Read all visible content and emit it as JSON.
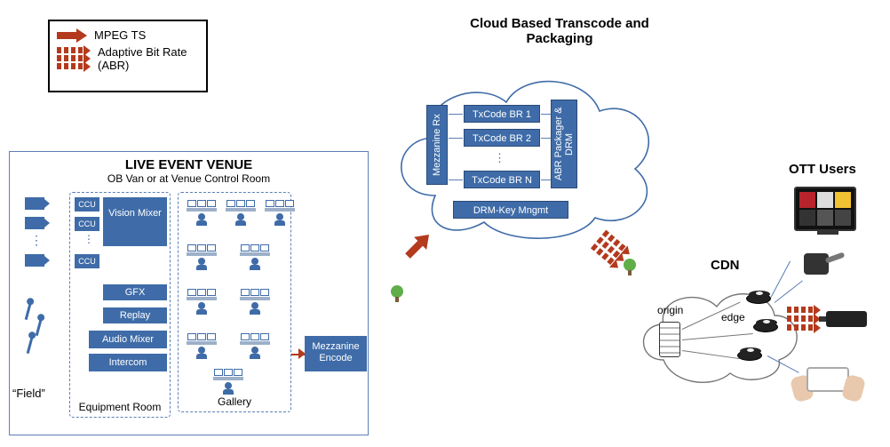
{
  "legend": {
    "mpeg": "MPEG TS",
    "abr": "Adaptive Bit Rate (ABR)"
  },
  "venue": {
    "title": "LIVE EVENT VENUE",
    "subtitle": "OB Van or at Venue Control Room",
    "field": "“Field”",
    "ccu": "CCU",
    "vision_mixer": "Vision Mixer",
    "gfx": "GFX",
    "replay": "Replay",
    "audio_mixer": "Audio Mixer",
    "intercom": "Intercom",
    "equipment_room": "Equipment Room",
    "gallery": "Gallery"
  },
  "mezzanine_encode": "Mezzanine Encode",
  "cloud": {
    "title": "Cloud Based Transcode and Packaging",
    "mezzanine_rx": "Mezzanine Rx",
    "txcode1": "TxCode BR 1",
    "txcode2": "TxCode BR 2",
    "txcodeN": "TxCode BR N",
    "abr_packager": "ABR Packager & DRM",
    "drm_key": "DRM-Key Mngmt"
  },
  "cdn": {
    "title": "CDN",
    "origin": "origin",
    "edge": "edge"
  },
  "ott": {
    "title": "OTT Users"
  }
}
